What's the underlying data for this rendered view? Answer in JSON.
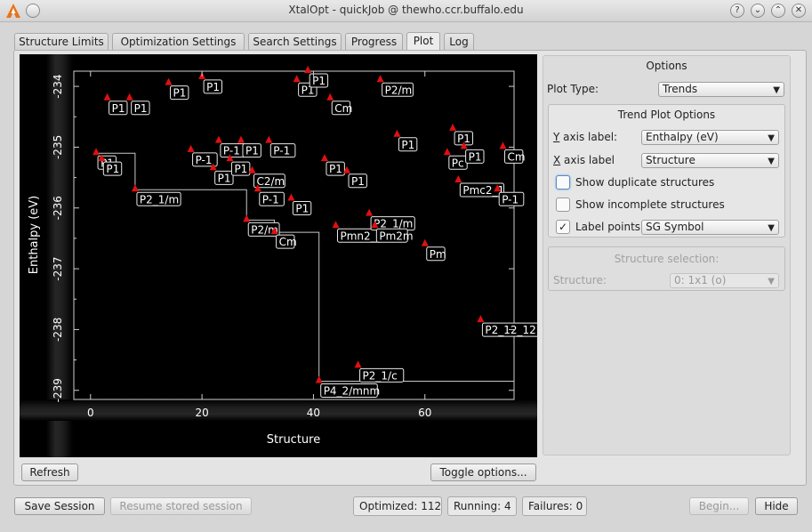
{
  "window": {
    "title": "XtalOpt - quickJob @ thewho.ccr.buffalo.edu"
  },
  "tabs": [
    {
      "label": "Structure Limits"
    },
    {
      "label": "Optimization Settings"
    },
    {
      "label": "Search Settings"
    },
    {
      "label": "Progress"
    },
    {
      "label": "Plot"
    },
    {
      "label": "Log"
    }
  ],
  "buttons": {
    "refresh": "Refresh",
    "toggle_options": "Toggle options...",
    "save_session": "Save Session",
    "resume_session": "Resume stored session",
    "begin": "Begin...",
    "hide": "Hide"
  },
  "status": {
    "optimized": "Optimized:  112",
    "running": "Running:  4",
    "failures": "Failures:  0"
  },
  "options": {
    "title": "Options",
    "plot_type_label": "Plot Type:",
    "plot_type_value": "Trends",
    "trend_title": "Trend Plot Options",
    "y_axis_label": "Y axis label:",
    "y_axis_value": "Enthalpy (eV)",
    "x_axis_label": "X axis label",
    "x_axis_value": "Structure",
    "show_duplicates": "Show duplicate structures",
    "show_incomplete": "Show incomplete structures",
    "label_points": "Label points",
    "label_points_value": "SG Symbol",
    "structure_selection_title": "Structure selection:",
    "structure_label": "Structure:",
    "structure_value": "0: 1x1 (o)"
  },
  "chart_data": {
    "type": "scatter",
    "xlabel": "Structure",
    "ylabel": "Enthalpy (eV)",
    "xlim": [
      -3,
      76
    ],
    "ylim": [
      -239.15,
      -233.75
    ],
    "xticks": [
      0,
      20,
      40,
      60
    ],
    "yticks": [
      -234,
      -235,
      -236,
      -237,
      -238,
      -239
    ],
    "points": [
      {
        "x": 1,
        "y": -235.1,
        "label": "P1"
      },
      {
        "x": 2,
        "y": -235.2,
        "label": "P1"
      },
      {
        "x": 3,
        "y": -234.2,
        "label": "P1"
      },
      {
        "x": 7,
        "y": -234.2,
        "label": "P1"
      },
      {
        "x": 8,
        "y": -235.7,
        "label": "P2_1/m"
      },
      {
        "x": 14,
        "y": -233.95,
        "label": "P1"
      },
      {
        "x": 18,
        "y": -235.05,
        "label": "P-1"
      },
      {
        "x": 20,
        "y": -233.85,
        "label": "P1"
      },
      {
        "x": 22,
        "y": -235.35,
        "label": "P1"
      },
      {
        "x": 23,
        "y": -234.9,
        "label": "P-1"
      },
      {
        "x": 25,
        "y": -235.2,
        "label": "P1"
      },
      {
        "x": 27,
        "y": -234.9,
        "label": "P1"
      },
      {
        "x": 28,
        "y": -236.2,
        "label": "P2/m"
      },
      {
        "x": 29,
        "y": -235.4,
        "label": "C2/m"
      },
      {
        "x": 30,
        "y": -235.7,
        "label": "P-1"
      },
      {
        "x": 32,
        "y": -234.9,
        "label": "P-1"
      },
      {
        "x": 33,
        "y": -236.4,
        "label": "Cm"
      },
      {
        "x": 36,
        "y": -235.85,
        "label": "P1"
      },
      {
        "x": 37,
        "y": -233.9,
        "label": "P1"
      },
      {
        "x": 39,
        "y": -233.75,
        "label": "P1"
      },
      {
        "x": 42,
        "y": -235.2,
        "label": "P1"
      },
      {
        "x": 41,
        "y": -238.85,
        "label": "P4_2/mnm"
      },
      {
        "x": 43,
        "y": -234.2,
        "label": "Cm"
      },
      {
        "x": 44,
        "y": -236.3,
        "label": "Pmn2_1"
      },
      {
        "x": 46,
        "y": -235.4,
        "label": "P1"
      },
      {
        "x": 48,
        "y": -238.6,
        "label": "P2_1/c"
      },
      {
        "x": 50,
        "y": -236.1,
        "label": "P2_1/m"
      },
      {
        "x": 51,
        "y": -236.3,
        "label": "Pm2m"
      },
      {
        "x": 52,
        "y": -233.9,
        "label": "P2/m"
      },
      {
        "x": 55,
        "y": -234.8,
        "label": "P1"
      },
      {
        "x": 60,
        "y": -236.6,
        "label": "Pm"
      },
      {
        "x": 64,
        "y": -235.1,
        "label": "Pc"
      },
      {
        "x": 65,
        "y": -234.7,
        "label": "P1"
      },
      {
        "x": 66,
        "y": -235.55,
        "label": "Pmc2_1"
      },
      {
        "x": 67,
        "y": -235.0,
        "label": "P1"
      },
      {
        "x": 70,
        "y": -237.85,
        "label": "P2_12_12"
      },
      {
        "x": 73,
        "y": -235.7,
        "label": "P-1"
      },
      {
        "x": 74,
        "y": -235.0,
        "label": "Cm"
      }
    ],
    "trend_line": [
      {
        "x": 1,
        "y": -235.1
      },
      {
        "x": 8,
        "y": -235.1
      },
      {
        "x": 8,
        "y": -235.7
      },
      {
        "x": 28,
        "y": -235.7
      },
      {
        "x": 28,
        "y": -236.2
      },
      {
        "x": 33,
        "y": -236.2
      },
      {
        "x": 33,
        "y": -236.4
      },
      {
        "x": 41,
        "y": -236.4
      },
      {
        "x": 41,
        "y": -238.85
      },
      {
        "x": 76,
        "y": -238.85
      }
    ]
  }
}
